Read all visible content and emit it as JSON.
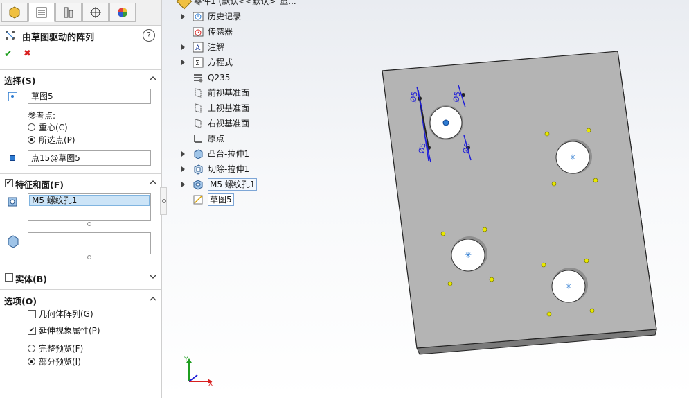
{
  "tabs": [
    {
      "name": "featuremanager"
    },
    {
      "name": "propertymanager"
    },
    {
      "name": "configurationmanager"
    },
    {
      "name": "dimxpert"
    },
    {
      "name": "display-manager"
    }
  ],
  "pm": {
    "title": "由草图驱动的阵列",
    "help_label": "?",
    "ok_symbol": "✔",
    "cancel_symbol": "✖",
    "selection": {
      "header": "选择(S)",
      "sketch_value": "草图5",
      "ref_point_label": "参考点:",
      "option_centroid": "重心(C)",
      "option_selected": "所选点(P)",
      "selected_option": "所选点(P)",
      "point_value": "点15@草图5"
    },
    "features": {
      "header": "特征和面(F)",
      "checked": true,
      "list_items": [
        "M5 螺纹孔1"
      ],
      "faces_items": []
    },
    "bodies": {
      "header": "实体(B)",
      "checked": false
    },
    "options": {
      "header": "选项(O)",
      "geometry_pattern": "几何体阵列(G)",
      "geometry_pattern_checked": false,
      "propagate_visual": "延伸视象属性(P)",
      "propagate_visual_checked": true,
      "full_preview": "完整预览(F)",
      "partial_preview": "部分预览(I)",
      "selected_preview": "部分预览(I)"
    }
  },
  "tree": {
    "root_label": "零件1 (默认<<默认>_显...",
    "items": [
      {
        "label": "历史记录",
        "icon": "history-icon",
        "expandable": true
      },
      {
        "label": "传感器",
        "icon": "sensor-icon",
        "expandable": false
      },
      {
        "label": "注解",
        "icon": "annotation-icon",
        "expandable": true
      },
      {
        "label": "方程式",
        "icon": "equation-icon",
        "expandable": true
      },
      {
        "label": "Q235",
        "icon": "material-icon",
        "expandable": false
      },
      {
        "label": "前视基准面",
        "icon": "plane-icon",
        "expandable": false
      },
      {
        "label": "上视基准面",
        "icon": "plane-icon",
        "expandable": false
      },
      {
        "label": "右视基准面",
        "icon": "plane-icon",
        "expandable": false
      },
      {
        "label": "原点",
        "icon": "origin-icon",
        "expandable": false
      },
      {
        "label": "凸台-拉伸1",
        "icon": "boss-extrude-icon",
        "expandable": true
      },
      {
        "label": "切除-拉伸1",
        "icon": "cut-extrude-icon",
        "expandable": true
      },
      {
        "label": "M5 螺纹孔1",
        "icon": "hole-wizard-icon",
        "expandable": true,
        "state": "boxed"
      },
      {
        "label": "草图5",
        "icon": "sketch-icon",
        "expandable": false,
        "state": "selected"
      }
    ]
  },
  "viewport": {
    "dim_labels": [
      "Ø5",
      "Ø5",
      "Ø5",
      "Ø5"
    ],
    "triad_x": "X",
    "triad_y": "Y",
    "plate_color": "#b4b4b4",
    "sketch_color": "#1f1fd8",
    "preview_color": "#e8e800",
    "point_color": "#2d7bd1"
  }
}
